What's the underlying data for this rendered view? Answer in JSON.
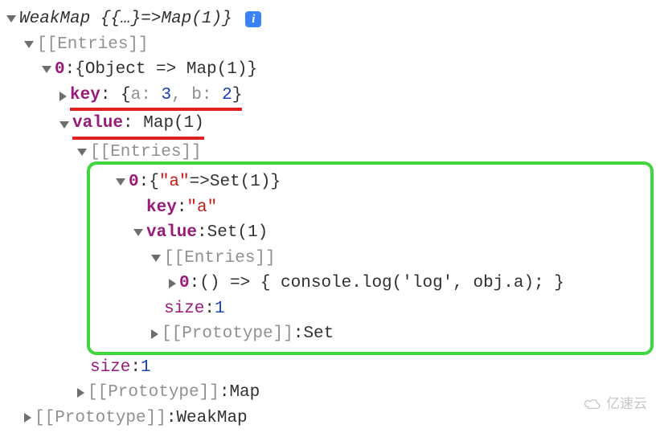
{
  "root": {
    "type_label": "WeakMap",
    "summary_open": "{{…}",
    "summary_arrow": " => ",
    "summary_close": "Map(1)}",
    "info": "i"
  },
  "entries_label": "[[Entries]]",
  "prototype_label": "[[Prototype]]",
  "size_label": "size",
  "entry0": {
    "index": "0",
    "summary": "{Object => Map(1)}",
    "key_label": "key",
    "key_value": "{a: 3, b: 2}",
    "key_a_label": "a",
    "key_a_val": "3",
    "key_b_label": "b",
    "key_b_val": "2",
    "value_label": "value",
    "value_summary": "Map(1)"
  },
  "inner": {
    "entry_index": "0",
    "entry_summary_open": "{",
    "entry_key_literal": "\"a\"",
    "entry_arrow": " => ",
    "entry_value_type": "Set(1)",
    "entry_summary_close": "}",
    "key_label": "key",
    "key_value": "\"a\"",
    "value_label": "value",
    "value_summary": "Set(1)",
    "set_entry_index": "0",
    "set_entry_value": "() => { console.log('log', obj.a); }",
    "set_size": "1",
    "set_proto": "Set"
  },
  "outer": {
    "map_size": "1",
    "map_proto": "Map",
    "weakmap_proto": "WeakMap"
  },
  "watermark": "亿速云"
}
